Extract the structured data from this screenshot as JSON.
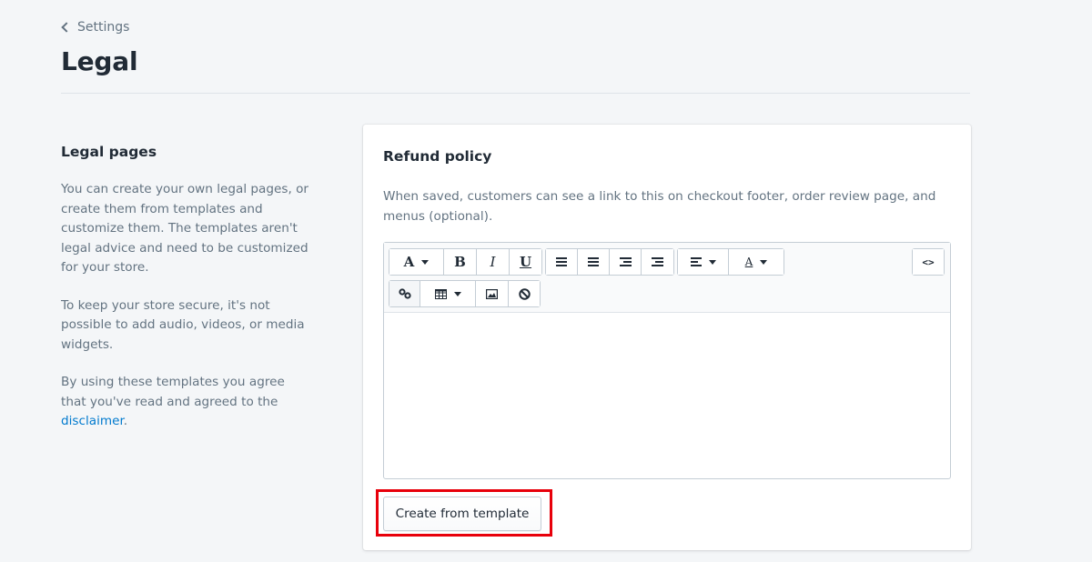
{
  "breadcrumb": {
    "label": "Settings",
    "icon": "chevron-left-icon"
  },
  "page": {
    "title": "Legal"
  },
  "annotation": {
    "title": "Legal pages",
    "paragraphs": [
      "You can create your own legal pages, or create them from templates and customize them. The templates aren't legal advice and need to be customized for your store.",
      "To keep your store secure, it's not possible to add audio, videos, or media widgets."
    ],
    "agree_text": "By using these templates you agree that you've read and agreed to the ",
    "disclaimer_link": "disclaimer",
    "agree_suffix": "."
  },
  "card": {
    "title": "Refund policy",
    "description": "When saved, customers can see a link to this on checkout footer, order review page, and menus (optional).",
    "editor": {
      "content": "",
      "toolbar": {
        "font": "A",
        "bold": "B",
        "italic": "I",
        "underline": "U",
        "text_color": "A",
        "source": "<>"
      }
    },
    "create_button": "Create from template"
  },
  "colors": {
    "background": "#f4f6f8",
    "link": "#007ace",
    "highlight": "#e8000b"
  }
}
